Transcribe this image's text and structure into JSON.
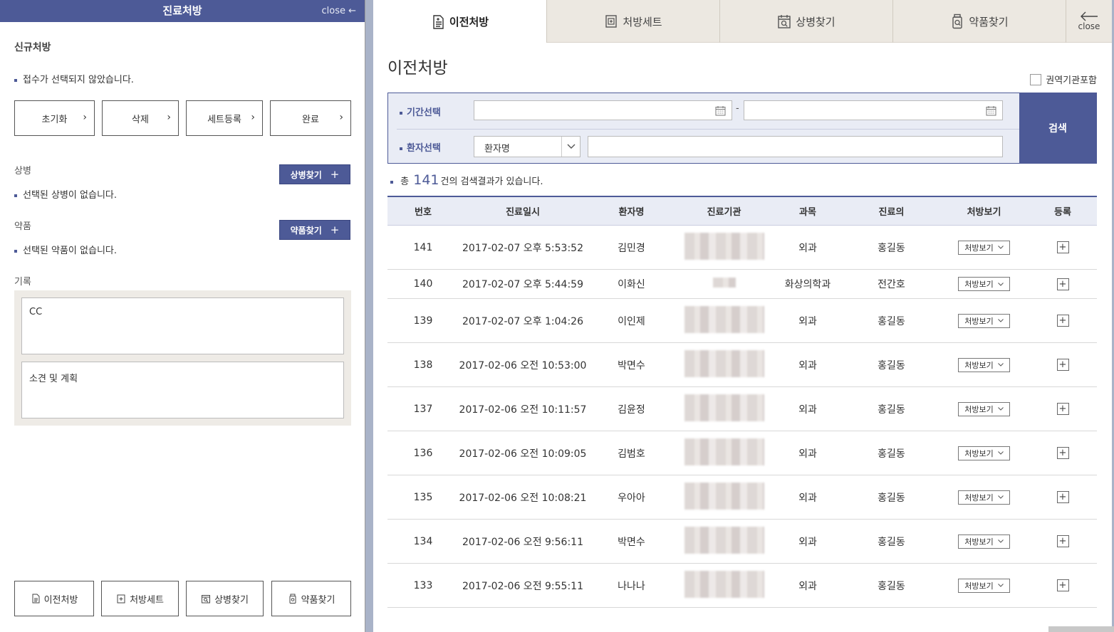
{
  "left": {
    "header_title": "진료처방",
    "close_label": "close ←",
    "new_rx_title": "신규처방",
    "reception_notice": "접수가 선택되지 않았습니다.",
    "buttons": {
      "reset": "초기화",
      "delete": "삭제",
      "set_register": "세트등록",
      "complete": "완료"
    },
    "disease": {
      "label": "상병",
      "find_label": "상병찾기",
      "empty": "선택된 상병이 없습니다."
    },
    "drug": {
      "label": "약품",
      "find_label": "약품찾기",
      "empty": "선택된 약품이 없습니다."
    },
    "record": {
      "label": "기록",
      "cc": "CC",
      "plan": "소견 및 계획"
    },
    "bottom": {
      "prev_rx": "이전처방",
      "rx_set": "처방세트",
      "find_disease": "상병찾기",
      "find_drug": "약품찾기"
    }
  },
  "tabs": [
    {
      "label": "이전처방",
      "icon": "document-icon",
      "active": true
    },
    {
      "label": "처방세트",
      "icon": "rx-set-icon",
      "active": false
    },
    {
      "label": "상병찾기",
      "icon": "calendar-search-icon",
      "active": false
    },
    {
      "label": "약품찾기",
      "icon": "drug-bottle-icon",
      "active": false
    }
  ],
  "tab_close_label": "close",
  "main": {
    "title": "이전처방",
    "include_region_label": "권역기관포함",
    "search": {
      "period_label": "기간선택",
      "patient_label": "환자선택",
      "select_value": "환자명",
      "button": "검색",
      "date_sep": "-"
    },
    "result": {
      "prefix": "총",
      "count": "141",
      "suffix": "건의 검색결과가 있습니다."
    }
  },
  "table": {
    "headers": [
      "번호",
      "진료일시",
      "환자명",
      "진료기관",
      "과목",
      "진료의",
      "처방보기",
      "등록"
    ],
    "rx_button": "처방보기",
    "rows": [
      {
        "no": "141",
        "date": "2017-02-07 오후 5:53:52",
        "patient": "김민경",
        "dept": "외과",
        "doctor": "홍길동",
        "small_org": false
      },
      {
        "no": "140",
        "date": "2017-02-07 오후 5:44:59",
        "patient": "이화신",
        "dept": "화상의학과",
        "doctor": "전간호",
        "small_org": true
      },
      {
        "no": "139",
        "date": "2017-02-07 오후 1:04:26",
        "patient": "이인제",
        "dept": "외과",
        "doctor": "홍길동",
        "small_org": false
      },
      {
        "no": "138",
        "date": "2017-02-06 오전 10:53:00",
        "patient": "박면수",
        "dept": "외과",
        "doctor": "홍길동",
        "small_org": false
      },
      {
        "no": "137",
        "date": "2017-02-06 오전 10:11:57",
        "patient": "김윤정",
        "dept": "외과",
        "doctor": "홍길동",
        "small_org": false
      },
      {
        "no": "136",
        "date": "2017-02-06 오전 10:09:05",
        "patient": "김범호",
        "dept": "외과",
        "doctor": "홍길동",
        "small_org": false
      },
      {
        "no": "135",
        "date": "2017-02-06 오전 10:08:21",
        "patient": "우아아",
        "dept": "외과",
        "doctor": "홍길동",
        "small_org": false
      },
      {
        "no": "134",
        "date": "2017-02-06 오전 9:56:11",
        "patient": "박면수",
        "dept": "외과",
        "doctor": "홍길동",
        "small_org": false
      },
      {
        "no": "133",
        "date": "2017-02-06 오전 9:55:11",
        "patient": "나나나",
        "dept": "외과",
        "doctor": "홍길동",
        "small_org": false
      }
    ]
  },
  "colors": {
    "accent": "#4d5a97",
    "tab_bg": "#ece8e1",
    "record_bg": "#eeebe6"
  }
}
